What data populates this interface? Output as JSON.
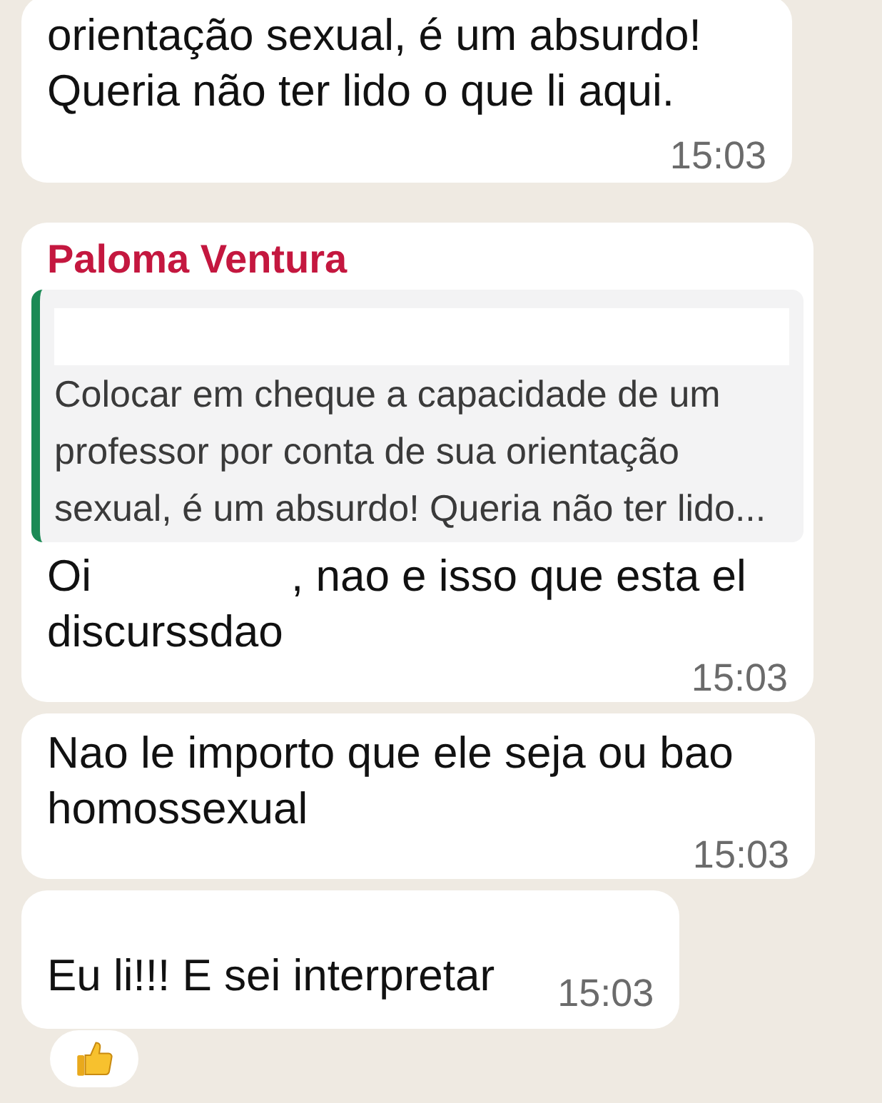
{
  "messages": [
    {
      "kind": "plain",
      "text": "orientação sexual, é um absurdo! Queria não ter lido o que li aqui.",
      "time": "15:03"
    },
    {
      "kind": "reply",
      "sender": "Paloma Ventura",
      "quote": "Colocar em cheque a capacidade de um professor por conta de sua orientação sexual, é um absurdo! Queria não ter lido...",
      "text_before": "Oi",
      "text_after": ", nao e isso que esta el discurssdao",
      "time": "15:03"
    },
    {
      "kind": "plain",
      "text": "Nao le importo que ele seja ou bao homossexual",
      "time": "15:03"
    },
    {
      "kind": "headed",
      "text": "Eu li!!! E sei interpretar",
      "time": "15:03",
      "reacted": true
    }
  ]
}
